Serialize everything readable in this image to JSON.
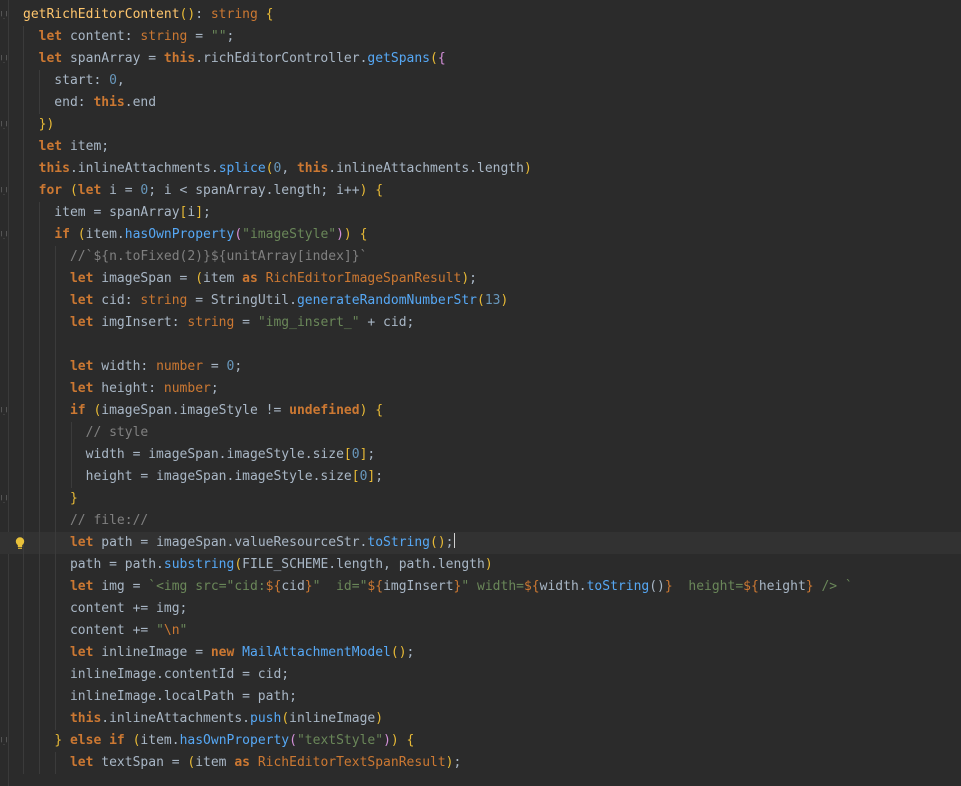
{
  "editor": {
    "lines": [
      "getRichEditorContent(): string {",
      "  let content: string = \"\";",
      "  let spanArray = this.richEditorController.getSpans({",
      "    start: 0,",
      "    end: this.end",
      "  })",
      "  let item;",
      "  this.inlineAttachments.splice(0, this.inlineAttachments.length)",
      "  for (let i = 0; i < spanArray.length; i++) {",
      "    item = spanArray[i];",
      "    if (item.hasOwnProperty(\"imageStyle\")) {",
      "      //`${n.toFixed(2)}${unitArray[index]}`",
      "      let imageSpan = (item as RichEditorImageSpanResult);",
      "      let cid: string = StringUtil.generateRandomNumberStr(13)",
      "      let imgInsert: string = \"img_insert_\" + cid;",
      "",
      "      let width: number = 0;",
      "      let height: number;",
      "      if (imageSpan.imageStyle != undefined) {",
      "        // style",
      "        width = imageSpan.imageStyle.size[0];",
      "        height = imageSpan.imageStyle.size[0];",
      "      }",
      "      // file://",
      "      let path = imageSpan.valueResourceStr.toString();",
      "      path = path.substring(FILE_SCHEME.length, path.length)",
      "      let img = `<img src=\"cid:${cid}\"  id=\"${imgInsert}\" width=${width.toString()}  height=${height} /> `",
      "      content += img;",
      "      content += \"\\n\"",
      "      let inlineImage = new MailAttachmentModel();",
      "      inlineImage.contentId = cid;",
      "      inlineImage.localPath = path;",
      "      this.inlineAttachments.push(inlineImage)",
      "    } else if (item.hasOwnProperty(\"textStyle\")) {",
      "      let textSpan = (item as RichEditorTextSpanResult);"
    ],
    "current_line": 25,
    "intention_icon": "lightbulb-icon",
    "fold_marker_icon": "fold-marker-icon",
    "colors": {
      "background": "#2b2b2b",
      "current_line": "#323232",
      "default_text": "#a9b7c6",
      "keyword": "#cc7832",
      "function": "#ffc66d",
      "method_call": "#56a8f5",
      "string": "#6a8759",
      "number": "#6897bb",
      "comment": "#808080",
      "bulb": "#e8c13a"
    }
  }
}
